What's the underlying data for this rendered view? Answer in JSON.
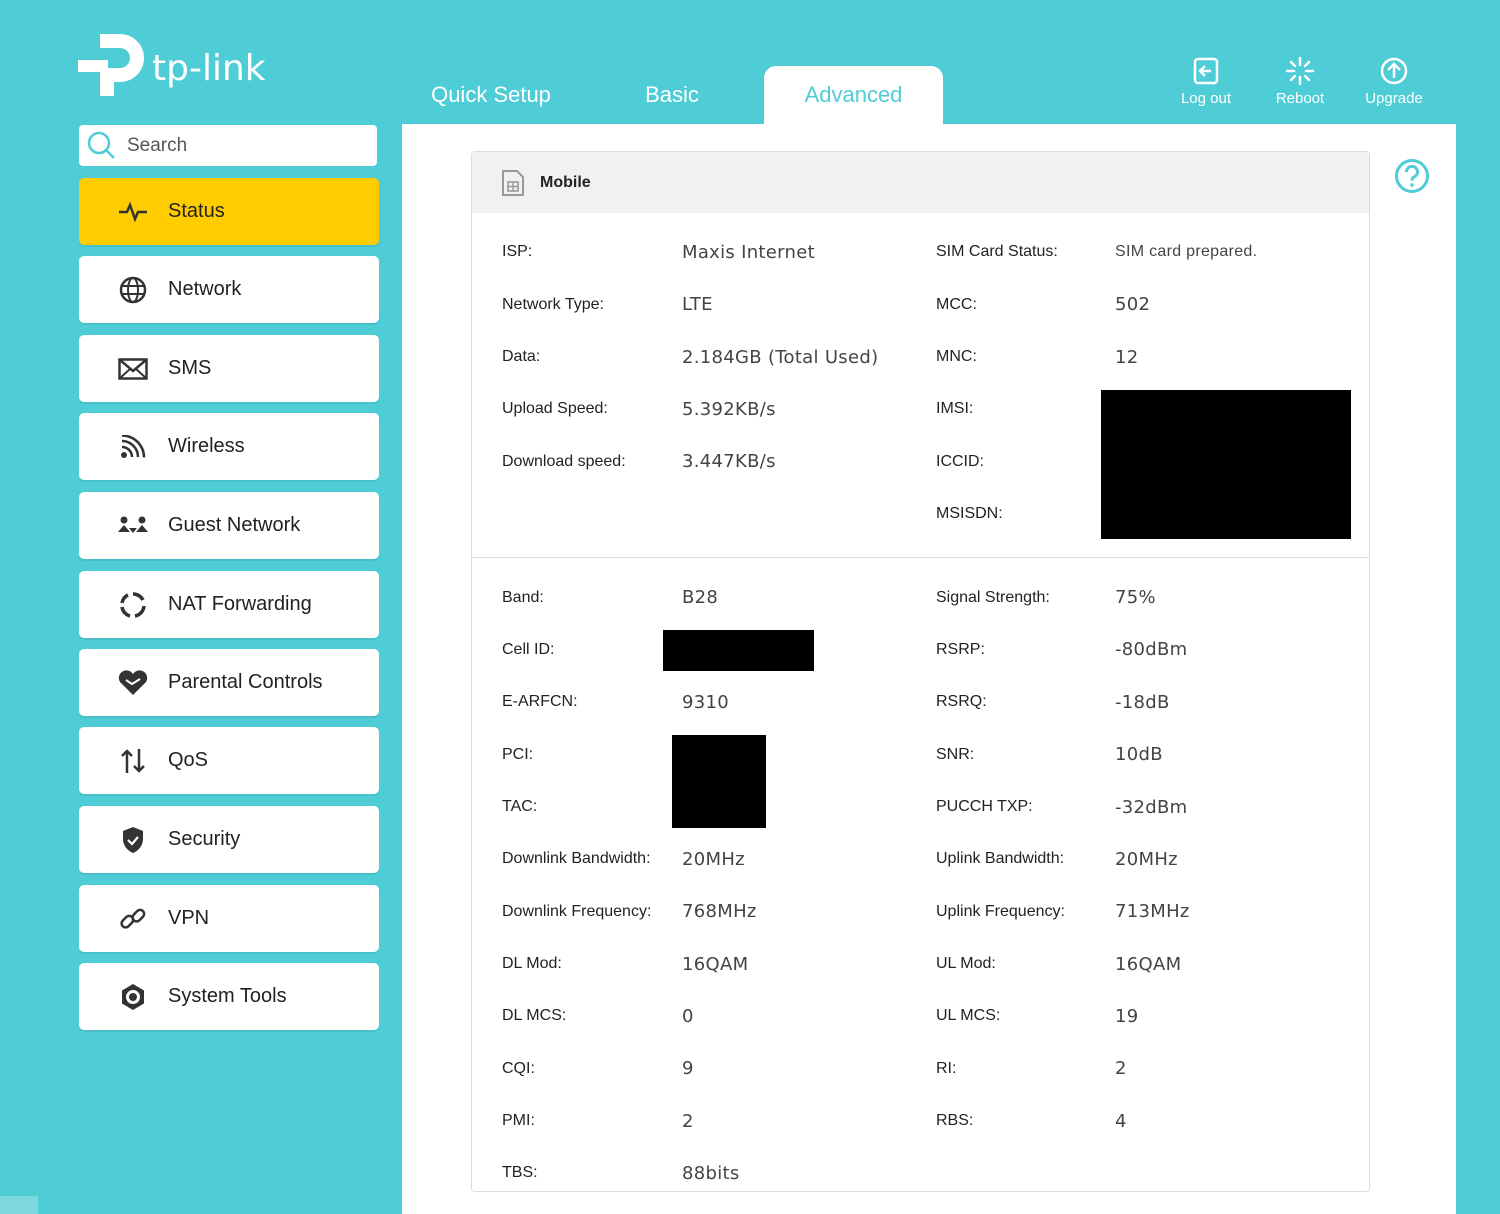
{
  "brand": {
    "name": "tp-link"
  },
  "nav": {
    "tabs": [
      {
        "label": "Quick Setup"
      },
      {
        "label": "Basic"
      },
      {
        "label": "Advanced"
      }
    ],
    "active_tab": "Advanced",
    "actions": [
      {
        "label": "Log out",
        "icon": "logout-icon"
      },
      {
        "label": "Reboot",
        "icon": "reboot-icon"
      },
      {
        "label": "Upgrade",
        "icon": "upgrade-icon"
      }
    ]
  },
  "sidebar": {
    "search_placeholder": "Search",
    "items": [
      {
        "label": "Status",
        "icon": "pulse-icon",
        "active": true
      },
      {
        "label": "Network",
        "icon": "globe-icon"
      },
      {
        "label": "SMS",
        "icon": "envelope-icon"
      },
      {
        "label": "Wireless",
        "icon": "wifi-icon"
      },
      {
        "label": "Guest Network",
        "icon": "guests-icon"
      },
      {
        "label": "NAT Forwarding",
        "icon": "nat-icon"
      },
      {
        "label": "Parental Controls",
        "icon": "heart-icon"
      },
      {
        "label": "QoS",
        "icon": "updown-arrows-icon"
      },
      {
        "label": "Security",
        "icon": "shield-icon"
      },
      {
        "label": "VPN",
        "icon": "link-icon"
      },
      {
        "label": "System Tools",
        "icon": "gear-icon"
      }
    ]
  },
  "panel": {
    "title": "Mobile",
    "section1": {
      "left": [
        {
          "label": "ISP:",
          "value": "Maxis Internet"
        },
        {
          "label": "Network Type:",
          "value": "LTE"
        },
        {
          "label": "Data:",
          "value": "2.184GB (Total Used)"
        },
        {
          "label": "Upload Speed:",
          "value": "5.392KB/s"
        },
        {
          "label": "Download speed:",
          "value": "3.447KB/s"
        }
      ],
      "right": [
        {
          "label": "SIM Card Status:",
          "value": "SIM card prepared."
        },
        {
          "label": "MCC:",
          "value": "502"
        },
        {
          "label": "MNC:",
          "value": "12"
        },
        {
          "label": "IMSI:",
          "value": ""
        },
        {
          "label": "ICCID:",
          "value": ""
        },
        {
          "label": "MSISDN:",
          "value": ""
        }
      ]
    },
    "section2": {
      "left": [
        {
          "label": "Band:",
          "value": "B28"
        },
        {
          "label": "Cell ID:",
          "value": ""
        },
        {
          "label": "E-ARFCN:",
          "value": "9310"
        },
        {
          "label": "PCI:",
          "value": ""
        },
        {
          "label": "TAC:",
          "value": ""
        },
        {
          "label": "Downlink Bandwidth:",
          "value": "20MHz"
        },
        {
          "label": "Downlink Frequency:",
          "value": "768MHz"
        },
        {
          "label": "DL Mod:",
          "value": "16QAM"
        },
        {
          "label": "DL MCS:",
          "value": "0"
        },
        {
          "label": "CQI:",
          "value": "9"
        },
        {
          "label": "PMI:",
          "value": "2"
        },
        {
          "label": "TBS:",
          "value": "88bits"
        }
      ],
      "right": [
        {
          "label": "Signal Strength:",
          "value": "75%"
        },
        {
          "label": "RSRP:",
          "value": "-80dBm"
        },
        {
          "label": "RSRQ:",
          "value": "-18dB"
        },
        {
          "label": "SNR:",
          "value": "10dB"
        },
        {
          "label": "PUCCH TXP:",
          "value": "-32dBm"
        },
        {
          "label": "Uplink Bandwidth:",
          "value": "20MHz"
        },
        {
          "label": "Uplink Frequency:",
          "value": "713MHz"
        },
        {
          "label": "UL Mod:",
          "value": "16QAM"
        },
        {
          "label": "UL MCS:",
          "value": "19"
        },
        {
          "label": "RI:",
          "value": "2"
        },
        {
          "label": "RBS:",
          "value": "4"
        }
      ]
    }
  },
  "colors": {
    "background": "#4ecdd6",
    "active_item": "#ffcc00",
    "panel_header": "#f1f1f1"
  }
}
